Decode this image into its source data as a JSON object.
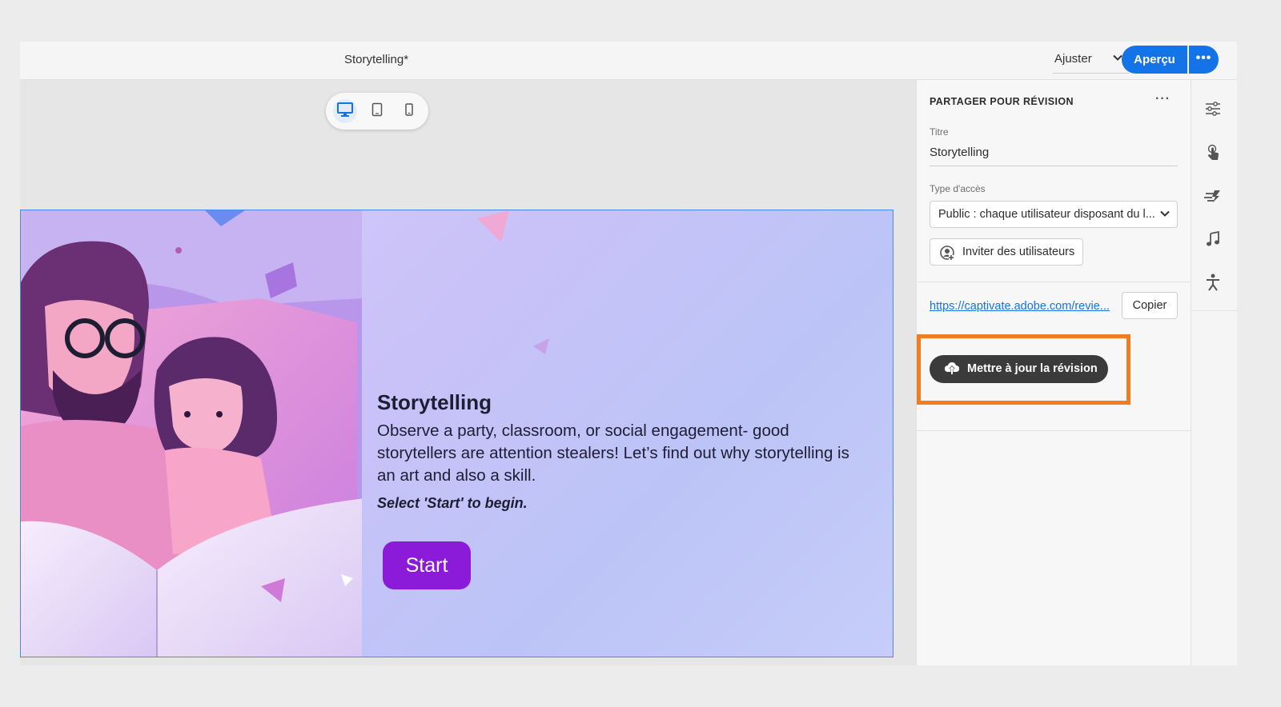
{
  "topbar": {
    "document_title": "Storytelling*",
    "zoom_value": "Ajuster",
    "preview_label": "Aperçu",
    "more_label": "•••"
  },
  "device_switcher": {
    "items": [
      {
        "name": "desktop-icon",
        "active": true
      },
      {
        "name": "tablet-icon",
        "active": false
      },
      {
        "name": "mobile-icon",
        "active": false
      }
    ]
  },
  "slide": {
    "title": "Storytelling",
    "body": "Observe a party, classroom, or social engagement- good storytellers are attention stealers! Let’s find out why storytelling is an art and also a skill.",
    "hint": "Select 'Start' to begin.",
    "start_label": "Start"
  },
  "panel": {
    "header": "PARTAGER POUR RÉVISION",
    "more_label": "···",
    "title_label": "Titre",
    "title_value": "Storytelling",
    "access_label": "Type d'accès",
    "access_value": "Public : chaque utilisateur disposant du l...",
    "invite_label": "Inviter des utilisateurs",
    "review_link": "https://captivate.adobe.com/revie...",
    "copy_label": "Copier",
    "update_label": "Mettre à jour la révision"
  },
  "rail": {
    "icons": [
      "properties-icon",
      "interaction-icon",
      "timing-icon",
      "audio-icon",
      "accessibility-icon"
    ]
  },
  "colors": {
    "accent": "#1473e6",
    "highlight": "#f47c20",
    "start_button": "#8c1ad9",
    "update_button": "#3b3b3b"
  }
}
